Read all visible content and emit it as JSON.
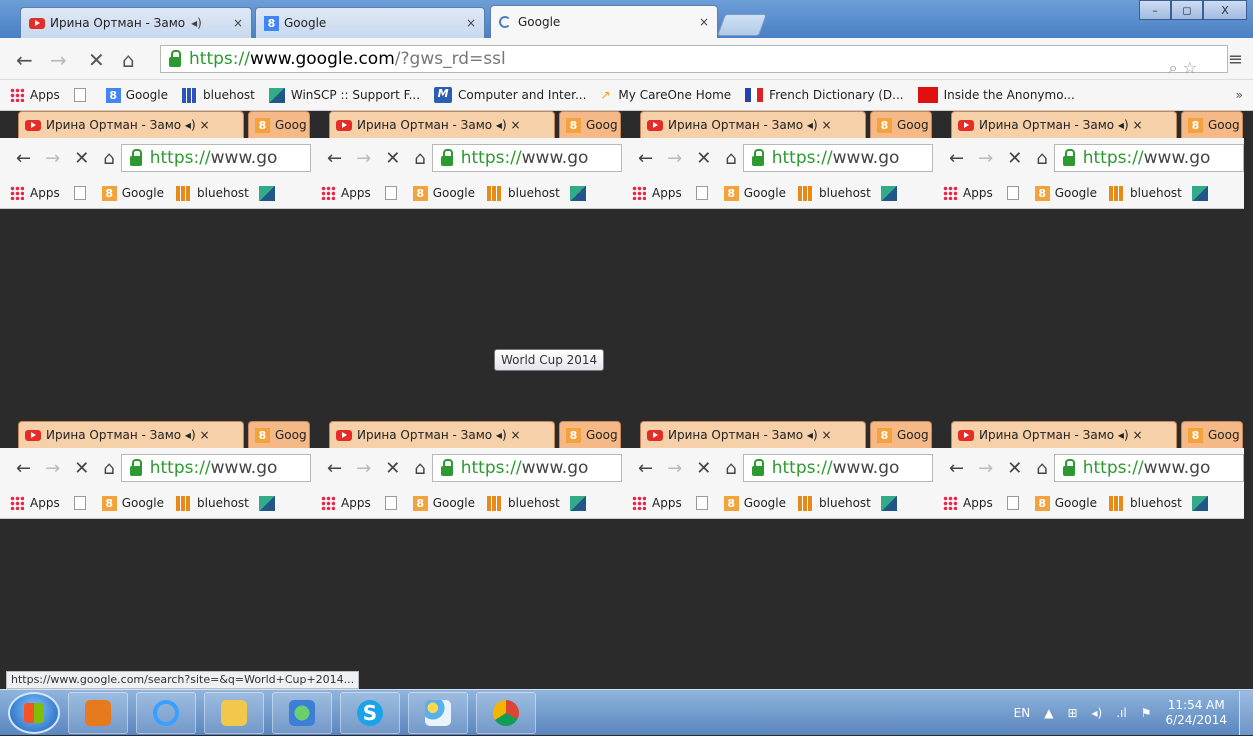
{
  "browser": {
    "tabs": [
      {
        "title": "Ирина Ортман - Замо",
        "icon": "youtube-icon",
        "audio": true
      },
      {
        "title": "Google",
        "icon": "google-plus-icon"
      },
      {
        "title": "Google",
        "icon": "loading-icon",
        "active": true
      }
    ],
    "window_buttons": {
      "minimize": "–",
      "maximize": "◻",
      "close": "X"
    },
    "toolbar": {
      "back": "←",
      "forward": "→",
      "stop": "✕",
      "home": "⌂",
      "url_https": "https://",
      "url_host": "www.google.com",
      "url_rest": "/?gws_rd=ssl",
      "zoom_icon": "⌕",
      "star_icon": "☆",
      "menu_icon": "≡"
    },
    "bookmarks": [
      {
        "label": "Apps",
        "icon": "apps-grid-icon"
      },
      {
        "label": "",
        "icon": "page-icon"
      },
      {
        "label": "Google",
        "icon": "google-plus-icon"
      },
      {
        "label": "bluehost",
        "icon": "bluehost-icon"
      },
      {
        "label": "WinSCP :: Support F...",
        "icon": "winscp-icon"
      },
      {
        "label": "Computer and Inter...",
        "icon": "m-icon"
      },
      {
        "label": "My CareOne Home",
        "icon": "careone-icon"
      },
      {
        "label": "French Dictionary (D...",
        "icon": "french-flag-icon"
      },
      {
        "label": "Inside the Anonymo...",
        "icon": "red-square-icon"
      }
    ],
    "bookmarks_more": "»"
  },
  "mirror": {
    "tab_yt": "Ирина Ортман - Замо",
    "tab_audio": "◂)",
    "tab_close": "×",
    "tab_google": "Goog",
    "url_https": "https://",
    "url_rest": "www.go",
    "bm_apps": "Apps",
    "bm_google": "Google",
    "bm_bluehost": "bluehost"
  },
  "tooltip": "World Cup 2014",
  "status_url": "https://www.google.com/search?site=&q=World+Cup+2014...",
  "taskbar": {
    "apps": [
      "outlook-icon",
      "internet-explorer-icon",
      "file-explorer-icon",
      "people-icon",
      "skype-icon",
      "paint-icon",
      "chrome-icon"
    ],
    "language": "EN",
    "tray_up": "▲",
    "time": "11:54 AM",
    "date": "6/24/2014"
  }
}
